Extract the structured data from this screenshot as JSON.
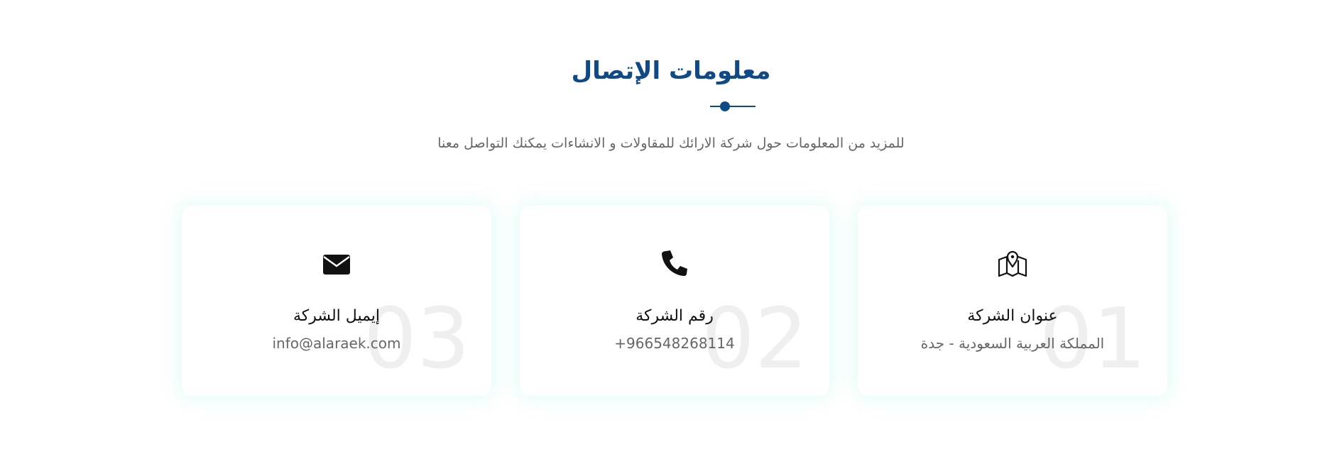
{
  "header": {
    "title": "معلومات الإتصال",
    "subtitle": "للمزيد من المعلومات حول شركة الارائك للمقاولات و الانشاءات يمكنك التواصل معنا"
  },
  "cards": [
    {
      "number": "01",
      "icon": "map-pin-icon",
      "label": "عنوان الشركة",
      "value": "المملكة العربية السعودية - جدة"
    },
    {
      "number": "02",
      "icon": "phone-icon",
      "label": "رقم الشركة",
      "value": "+966548268114"
    },
    {
      "number": "03",
      "icon": "envelope-icon",
      "label": "إيميل الشركة",
      "value": "info@alaraek.com"
    }
  ],
  "colors": {
    "accent": "#0f4a86",
    "text_muted": "#666666",
    "number_watermark": "#efefef"
  }
}
